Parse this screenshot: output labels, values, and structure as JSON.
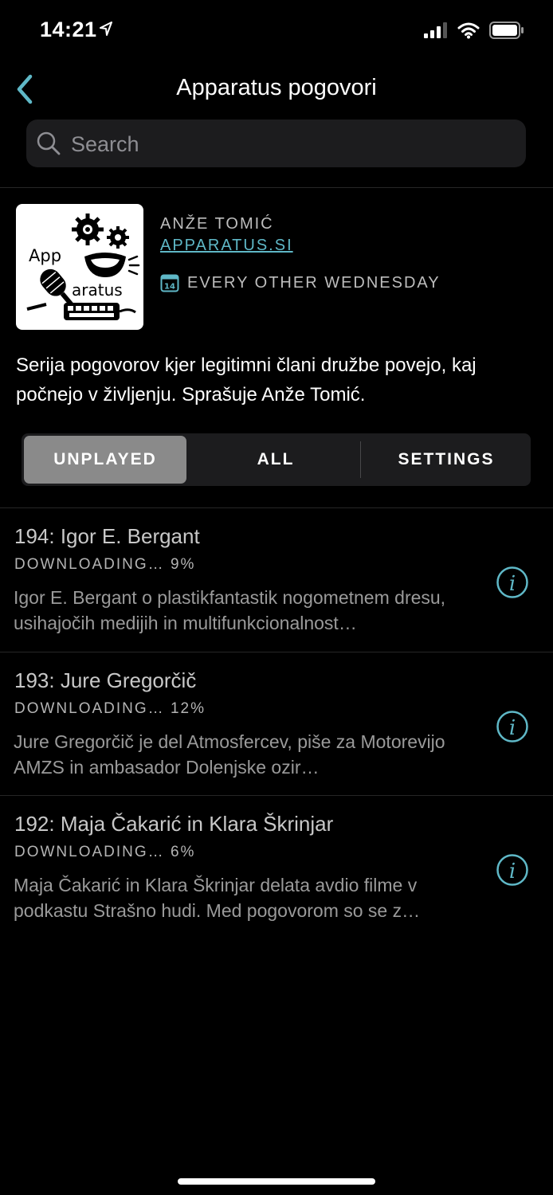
{
  "status_bar": {
    "time": "14:21"
  },
  "nav": {
    "title": "Apparatus pogovori"
  },
  "search": {
    "placeholder": "Search"
  },
  "podcast": {
    "artwork_text_1": "App",
    "artwork_text_2": "aratus",
    "author": "ANŽE TOMIĆ",
    "website": "APPARATUS.SI",
    "calendar_day": "14",
    "schedule": "EVERY OTHER WEDNESDAY",
    "description": "Serija pogovorov kjer legitimni člani družbe povejo, kaj počnejo v življenju. Sprašuje Anže Tomić."
  },
  "segments": {
    "unplayed": "UNPLAYED",
    "all": "ALL",
    "settings": "SETTINGS",
    "selected": "UNPLAYED"
  },
  "episodes": [
    {
      "title": "194: Igor E. Bergant",
      "status": "DOWNLOADING… 9%",
      "description": "Igor E. Bergant o plastikfantastik nogometnem dresu, usihajočih medijih in multifunkcionalnost…"
    },
    {
      "title": "193: Jure Gregorčič",
      "status": "DOWNLOADING… 12%",
      "description": "Jure Gregorčič je del Atmosfercev, piše za Motorevijo AMZS in ambasador Dolenjske ozir…"
    },
    {
      "title": "192: Maja Čakarić in Klara Škrinjar",
      "status": "DOWNLOADING… 6%",
      "description": "Maja Čakarić in Klara Škrinjar delata avdio filme v podkastu Strašno hudi. Med pogovorom so se z…"
    }
  ],
  "colors": {
    "accent": "#5fb8c7",
    "background": "#000000",
    "segment_selected": "#8a8a8a"
  },
  "icons": [
    "location-arrow-icon",
    "signal-icon",
    "wifi-icon",
    "battery-icon",
    "back-chevron-icon",
    "search-icon",
    "calendar-icon",
    "info-icon"
  ]
}
